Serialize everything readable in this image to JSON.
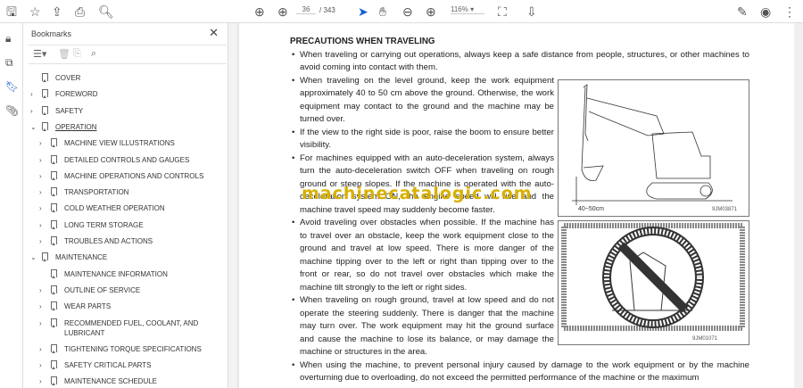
{
  "toolbar": {
    "page_current": "36",
    "page_total": "/ 343",
    "zoom": "116%"
  },
  "sidebar": {
    "title": "Bookmarks",
    "items": [
      {
        "label": "COVER",
        "level": 0,
        "expandable": false
      },
      {
        "label": "FOREWORD",
        "level": 0,
        "expandable": true
      },
      {
        "label": "SAFETY",
        "level": 0,
        "expandable": true
      },
      {
        "label": "OPERATION",
        "level": 0,
        "expandable": true,
        "expanded": true,
        "active": true
      },
      {
        "label": "MACHINE VIEW ILLUSTRATIONS",
        "level": 1,
        "expandable": true
      },
      {
        "label": "DETAILED CONTROLS AND GAUGES",
        "level": 1,
        "expandable": true
      },
      {
        "label": "MACHINE OPERATIONS AND CONTROLS",
        "level": 1,
        "expandable": true
      },
      {
        "label": "TRANSPORTATION",
        "level": 1,
        "expandable": true
      },
      {
        "label": "COLD WEATHER OPERATION",
        "level": 1,
        "expandable": true
      },
      {
        "label": "LONG TERM STORAGE",
        "level": 1,
        "expandable": true
      },
      {
        "label": "TROUBLES AND ACTIONS",
        "level": 1,
        "expandable": true
      },
      {
        "label": "MAINTENANCE",
        "level": 0,
        "expandable": true,
        "expanded": true
      },
      {
        "label": "MAINTENANCE INFORMATION",
        "level": 1,
        "expandable": false
      },
      {
        "label": "OUTLINE OF SERVICE",
        "level": 1,
        "expandable": true
      },
      {
        "label": "WEAR PARTS",
        "level": 1,
        "expandable": true
      },
      {
        "label": "RECOMMENDED FUEL, COOLANT, AND",
        "label2": "LUBRICANT",
        "level": 1,
        "expandable": true
      },
      {
        "label": "TIGHTENING TORQUE SPECIFICATIONS",
        "level": 1,
        "expandable": true
      },
      {
        "label": "SAFETY CRITICAL PARTS",
        "level": 1,
        "expandable": true
      },
      {
        "label": "MAINTENANCE SCHEDULE",
        "level": 1,
        "expandable": true
      }
    ]
  },
  "document": {
    "heading": "PRECAUTIONS WHEN TRAVELING",
    "bullets": [
      "When traveling or carrying out operations, always keep a safe distance from people, structures, or other machines to avoid coming into contact with them.",
      "When traveling on the level ground, keep the work equipment approximately 40 to 50 cm above the ground. Otherwise, the work equipment may contact to the ground and the machine may be turned over.",
      "If the view to the right side is poor, raise the boom to ensure better visibility.",
      "For machines equipped with an auto-deceleration system, always turn the auto-deceleration switch OFF when traveling on rough ground or steep slopes.  If the machine is operated with the auto-deceleration system ON, the engine speed will rise and the machine travel speed may suddenly become faster.",
      "Avoid traveling over obstacles when possible. If the machine has to travel over an obstacle, keep the work equipment close to the ground and travel at low speed. There is more danger of the machine tipping over to the left or right than tipping over to the front or rear, so do not travel over obstacles which make the machine tilt strongly to the left or right sides.",
      "When traveling on rough ground, travel at low speed and do not operate the steering suddenly. There is danger that the machine may turn over. The work equipment may hit the ground surface and cause the machine to lose its balance, or may damage the machine or structures in the area.",
      "When using the machine, to prevent personal injury caused by damage to the work equipment or by the machine overturning due to overloading, do not exceed the permitted performance of the machine or the maximum"
    ],
    "fig1": {
      "dimension": "40~50cm",
      "code": "9JM03871"
    },
    "fig2": {
      "code": "9JM01071"
    },
    "watermark": "machinecatalogic.com"
  }
}
